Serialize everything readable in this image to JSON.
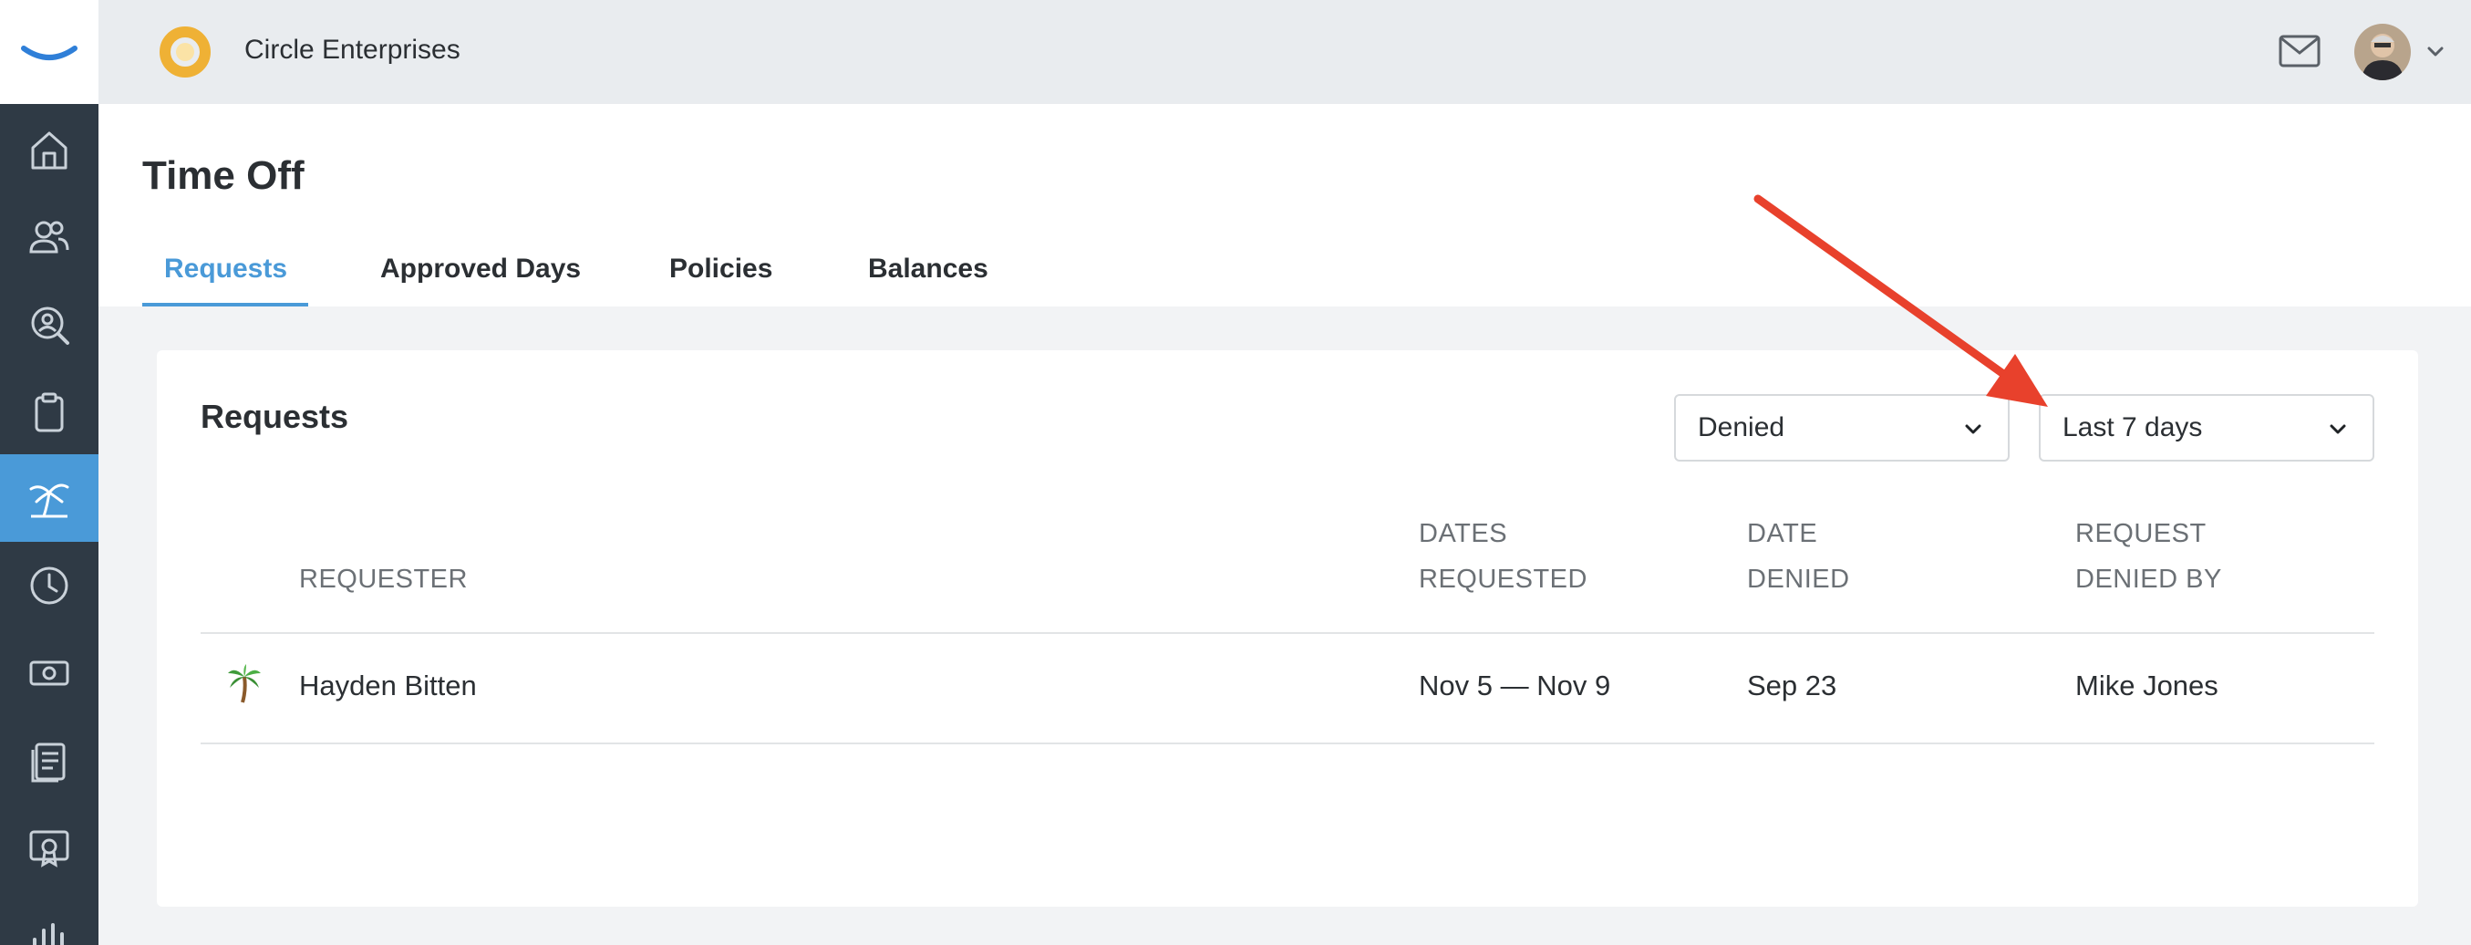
{
  "company": {
    "name": "Circle Enterprises"
  },
  "page": {
    "title": "Time Off"
  },
  "tabs": [
    {
      "label": "Requests",
      "active": true
    },
    {
      "label": "Approved Days",
      "active": false
    },
    {
      "label": "Policies",
      "active": false
    },
    {
      "label": "Balances",
      "active": false
    }
  ],
  "requests": {
    "title": "Requests",
    "status_filter": "Denied",
    "range_filter": "Last 7 days",
    "columns": {
      "requester": "REQUESTER",
      "dates_requested": [
        "DATES",
        "REQUESTED"
      ],
      "date_denied": [
        "DATE",
        "DENIED"
      ],
      "denied_by": [
        "REQUEST",
        "DENIED BY"
      ]
    },
    "rows": [
      {
        "requester": "Hayden Bitten",
        "dates_requested": "Nov 5 — Nov 9",
        "date_denied": "Sep 23",
        "denied_by": "Mike Jones"
      }
    ]
  },
  "sidebar": {
    "items": [
      {
        "icon": "home-icon"
      },
      {
        "icon": "people-icon"
      },
      {
        "icon": "search-person-icon"
      },
      {
        "icon": "clipboard-icon"
      },
      {
        "icon": "palm-tree-icon",
        "active": true
      },
      {
        "icon": "clock-icon"
      },
      {
        "icon": "money-icon"
      },
      {
        "icon": "documents-icon"
      },
      {
        "icon": "certificate-icon"
      },
      {
        "icon": "bar-chart-icon"
      }
    ]
  },
  "colors": {
    "accent": "#4a9ad8",
    "sidebar": "#2f3a45",
    "annotation": "#e8412c"
  }
}
